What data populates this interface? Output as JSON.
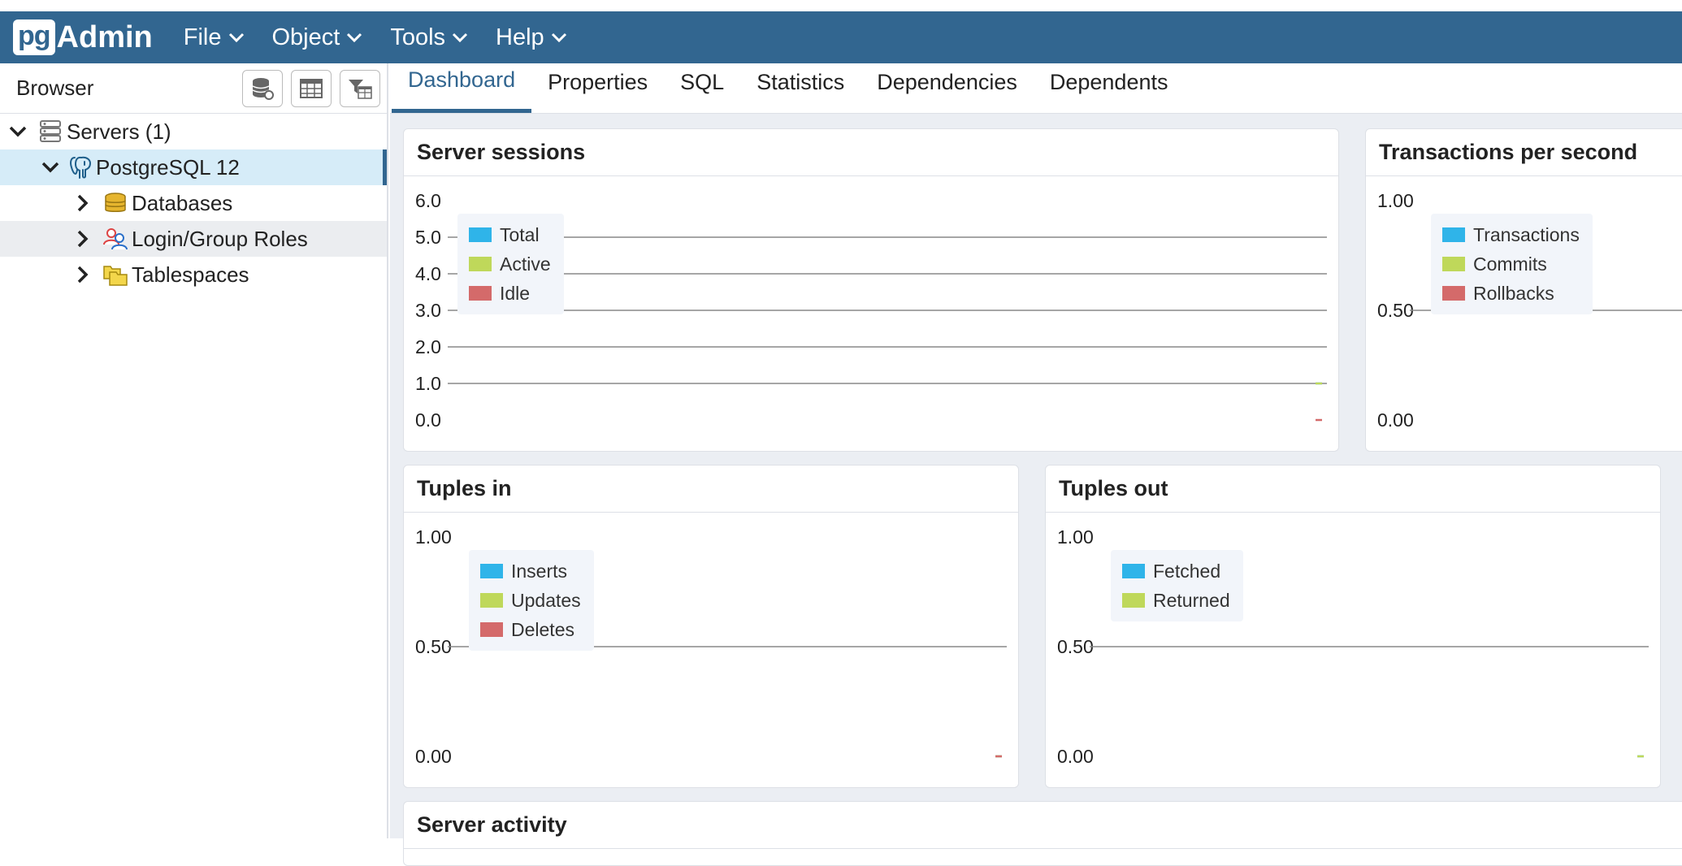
{
  "app": {
    "logo_pg": "pg",
    "logo_text": "Admin"
  },
  "menu": [
    "File",
    "Object",
    "Tools",
    "Help"
  ],
  "browser": {
    "title": "Browser",
    "tree": [
      {
        "label": "Servers (1)",
        "level": 0,
        "expanded": true,
        "icon": "servers-icon"
      },
      {
        "label": "PostgreSQL 12",
        "level": 1,
        "expanded": true,
        "icon": "postgresql-elephant-icon",
        "selected": true
      },
      {
        "label": "Databases",
        "level": 2,
        "expanded": false,
        "icon": "databases-icon"
      },
      {
        "label": "Login/Group Roles",
        "level": 2,
        "expanded": false,
        "icon": "roles-icon",
        "hover": true
      },
      {
        "label": "Tablespaces",
        "level": 2,
        "expanded": false,
        "icon": "tablespaces-icon"
      }
    ]
  },
  "tabs": [
    "Dashboard",
    "Properties",
    "SQL",
    "Statistics",
    "Dependencies",
    "Dependents"
  ],
  "active_tab": "Dashboard",
  "colors": {
    "accent": "#326690",
    "blue": "#2fb4e9",
    "green": "#bfd85a",
    "red": "#d46a6a"
  },
  "cards": {
    "sessions": {
      "title": "Server sessions"
    },
    "tps": {
      "title": "Transactions per second"
    },
    "tuples_in": {
      "title": "Tuples in"
    },
    "tuples_out": {
      "title": "Tuples out"
    },
    "activity": {
      "title": "Server activity"
    }
  },
  "chart_data": [
    {
      "type": "line",
      "title": "Server sessions",
      "ylim": [
        0,
        6
      ],
      "yticks": [
        "6.0",
        "5.0",
        "4.0",
        "3.0",
        "2.0",
        "1.0",
        "0.0"
      ],
      "series": [
        {
          "name": "Total",
          "color": "#2fb4e9",
          "values": [
            1
          ]
        },
        {
          "name": "Active",
          "color": "#bfd85a",
          "values": [
            1
          ]
        },
        {
          "name": "Idle",
          "color": "#d46a6a",
          "values": [
            0
          ]
        }
      ]
    },
    {
      "type": "line",
      "title": "Transactions per second",
      "ylim": [
        0,
        1
      ],
      "yticks": [
        "1.00",
        "0.50",
        "0.00"
      ],
      "series": [
        {
          "name": "Transactions",
          "color": "#2fb4e9",
          "values": [
            0
          ]
        },
        {
          "name": "Commits",
          "color": "#bfd85a",
          "values": [
            0
          ]
        },
        {
          "name": "Rollbacks",
          "color": "#d46a6a",
          "values": [
            0
          ]
        }
      ]
    },
    {
      "type": "line",
      "title": "Tuples in",
      "ylim": [
        0,
        1
      ],
      "yticks": [
        "1.00",
        "0.50",
        "0.00"
      ],
      "series": [
        {
          "name": "Inserts",
          "color": "#2fb4e9",
          "values": [
            0
          ]
        },
        {
          "name": "Updates",
          "color": "#bfd85a",
          "values": [
            0
          ]
        },
        {
          "name": "Deletes",
          "color": "#d46a6a",
          "values": [
            0
          ]
        }
      ]
    },
    {
      "type": "line",
      "title": "Tuples out",
      "ylim": [
        0,
        1
      ],
      "yticks": [
        "1.00",
        "0.50",
        "0.00"
      ],
      "series": [
        {
          "name": "Fetched",
          "color": "#2fb4e9",
          "values": [
            0
          ]
        },
        {
          "name": "Returned",
          "color": "#bfd85a",
          "values": [
            0
          ]
        }
      ]
    }
  ]
}
